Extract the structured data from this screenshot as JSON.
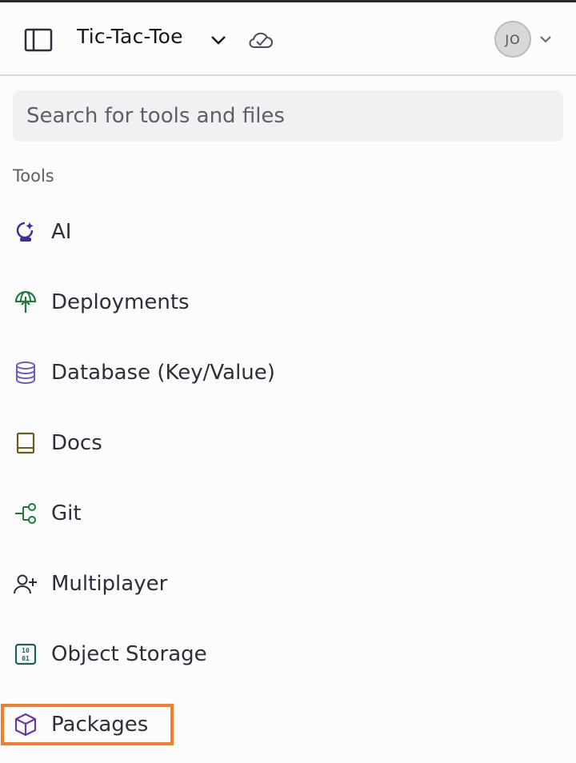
{
  "header": {
    "project_name": "Tic-Tac-Toe",
    "avatar_initials": "JO"
  },
  "search": {
    "placeholder": "Search for tools and files"
  },
  "tools_section": {
    "label": "Tools",
    "items": [
      {
        "label": "AI",
        "icon": "ai-sparkle-icon",
        "color": "#3b2f9e"
      },
      {
        "label": "Deployments",
        "icon": "deployments-icon",
        "color": "#1f7a3a"
      },
      {
        "label": "Database (Key/Value)",
        "icon": "database-icon",
        "color": "#6c5ac9"
      },
      {
        "label": "Docs",
        "icon": "book-icon",
        "color": "#6b5a1e"
      },
      {
        "label": "Git",
        "icon": "git-icon",
        "color": "#1f7a3a"
      },
      {
        "label": "Multiplayer",
        "icon": "user-plus-icon",
        "color": "#2a2f3a"
      },
      {
        "label": "Object Storage",
        "icon": "object-storage-icon",
        "color": "#1c5f5f"
      },
      {
        "label": "Packages",
        "icon": "package-icon",
        "color": "#6a3aa5"
      }
    ]
  },
  "colors": {
    "highlight": "#f57c2a",
    "search_bg": "#f0f1f2"
  }
}
